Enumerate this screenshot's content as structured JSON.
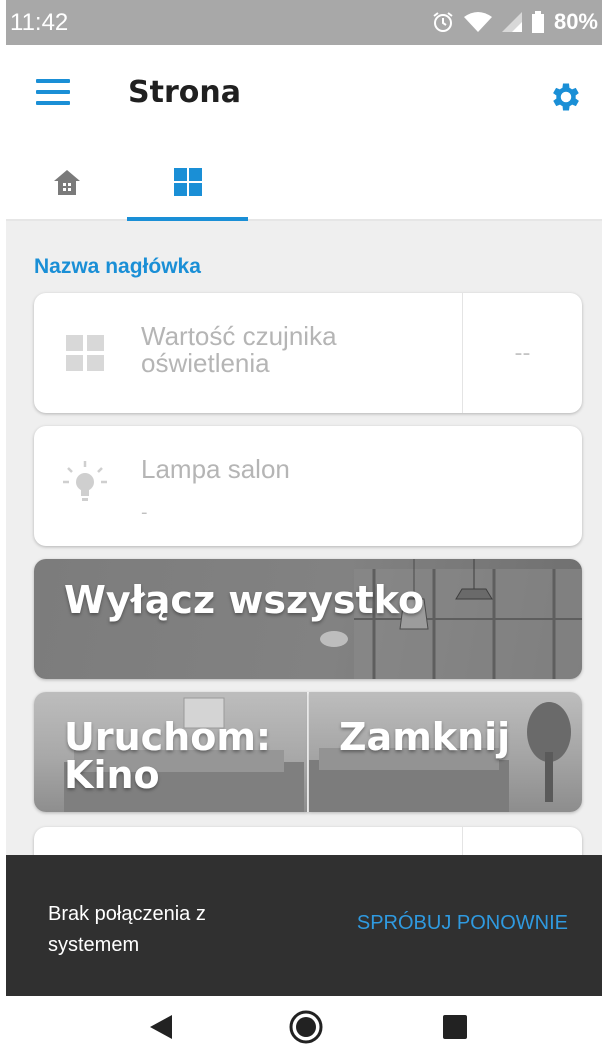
{
  "status_bar": {
    "time": "11:42",
    "battery": "80%"
  },
  "app_bar": {
    "title": "Strona"
  },
  "tabs": [
    {
      "name": "home",
      "icon": "home-icon",
      "active": false
    },
    {
      "name": "grid",
      "icon": "grid-icon",
      "active": true
    }
  ],
  "section": {
    "header": "Nazwa nagłówka"
  },
  "cards": {
    "sensor": {
      "label_line1": "Wartość czujnika",
      "label_line2": "oświetlenia",
      "value": "--",
      "icon": "grid-icon"
    },
    "lamp": {
      "label": "Lampa salon",
      "sub": "-",
      "icon": "bulb-icon"
    }
  },
  "scenes": {
    "off": {
      "label": "Wyłącz wszystko"
    },
    "kino": {
      "label": "Uruchom: Kino"
    },
    "close": {
      "label": "Zamknij"
    }
  },
  "snackbar": {
    "message": "Brak połączenia z systemem",
    "action": "SPRÓBUJ PONOWNIE"
  },
  "colors": {
    "accent": "#1a8fd6",
    "snackbar": "#303030",
    "status_bar": "#a8a8a8"
  }
}
